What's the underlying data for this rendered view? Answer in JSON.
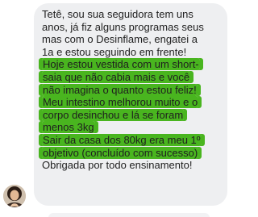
{
  "message": {
    "lines": [
      "Tetê, sou sua seguidora tem uns",
      "anos, já fiz alguns programas seus",
      "mas com o Desinflame, engatei a",
      "1a e estou seguindo em frente!",
      "Hoje estou vestida com um short-",
      "saia que não cabia mais e você",
      "não imagina o quanto estou feliz!",
      "Meu intestino melhorou muito e o",
      "corpo desinchou e lá se foram",
      "menos 3kg",
      "Sair da casa dos 80kg era meu 1º",
      "objetivo (concluído com sucesso)",
      "Obrigada por todo ensinamento!"
    ]
  },
  "colors": {
    "bubble_background": "#eeeff1",
    "highlight": "#49b51f",
    "text": "#1f1f1f"
  },
  "icons": {
    "sender_avatar": "sender-avatar"
  }
}
